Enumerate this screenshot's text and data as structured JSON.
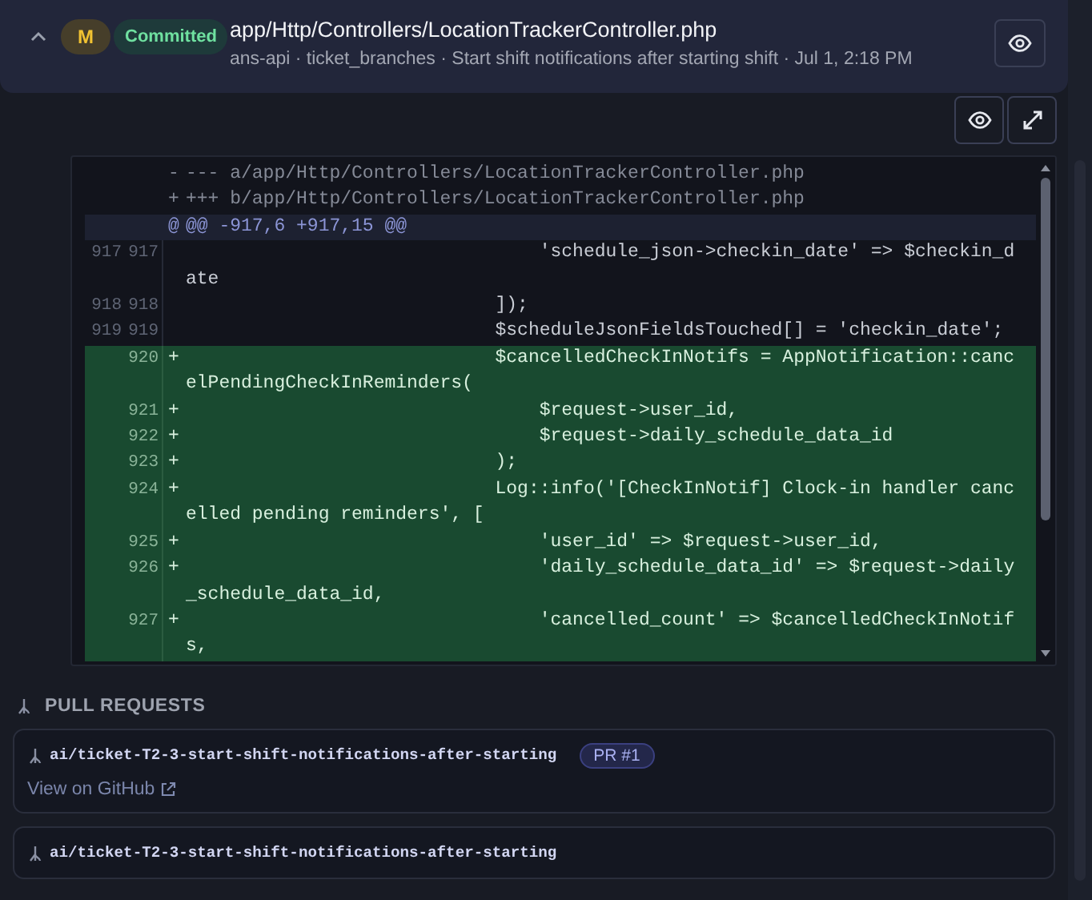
{
  "file_header": {
    "expanded": true,
    "status_badge": "M",
    "commit_badge": "Committed",
    "path": "app/Http/Controllers/LocationTrackerController.php",
    "subtitle": "ans-api · ticket_branches · Start shift notifications after starting shift · Jul 1, 2:18 PM"
  },
  "diff": {
    "lines": [
      {
        "kind": "meta",
        "sign": "-",
        "text": "--- a/app/Http/Controllers/LocationTrackerController.php"
      },
      {
        "kind": "meta",
        "sign": "+",
        "text": "+++ b/app/Http/Controllers/LocationTrackerController.php"
      },
      {
        "kind": "hunk",
        "sign": "@",
        "text": "@@ -917,6 +917,15 @@"
      },
      {
        "kind": "context",
        "old": "917",
        "new": "917",
        "text": "                                'schedule_json->checkin_date' => $checkin_date"
      },
      {
        "kind": "context",
        "old": "918",
        "new": "918",
        "text": "                            ]);"
      },
      {
        "kind": "context",
        "old": "919",
        "new": "919",
        "text": "                            $scheduleJsonFieldsTouched[] = 'checkin_date';"
      },
      {
        "kind": "add",
        "new": "920",
        "sign": "+",
        "text": "                            $cancelledCheckInNotifs = AppNotification::cancelPendingCheckInReminders("
      },
      {
        "kind": "add",
        "new": "921",
        "sign": "+",
        "text": "                                $request->user_id,"
      },
      {
        "kind": "add",
        "new": "922",
        "sign": "+",
        "text": "                                $request->daily_schedule_data_id"
      },
      {
        "kind": "add",
        "new": "923",
        "sign": "+",
        "text": "                            );"
      },
      {
        "kind": "add",
        "new": "924",
        "sign": "+",
        "text": "                            Log::info('[CheckInNotif] Clock-in handler cancelled pending reminders', ["
      },
      {
        "kind": "add",
        "new": "925",
        "sign": "+",
        "text": "                                'user_id' => $request->user_id,"
      },
      {
        "kind": "add",
        "new": "926",
        "sign": "+",
        "text": "                                'daily_schedule_data_id' => $request->daily_schedule_data_id,"
      },
      {
        "kind": "add",
        "new": "927",
        "sign": "+",
        "text": "                                'cancelled_count' => $cancelledCheckInNotifs,"
      }
    ]
  },
  "pull_requests": {
    "heading": "PULL REQUESTS",
    "items": [
      {
        "branch": "ai/ticket-T2-3-start-shift-notifications-after-starting",
        "badge": "PR #1",
        "link": "View on GitHub"
      },
      {
        "branch": "ai/ticket-T2-3-start-shift-notifications-after-starting"
      }
    ]
  }
}
